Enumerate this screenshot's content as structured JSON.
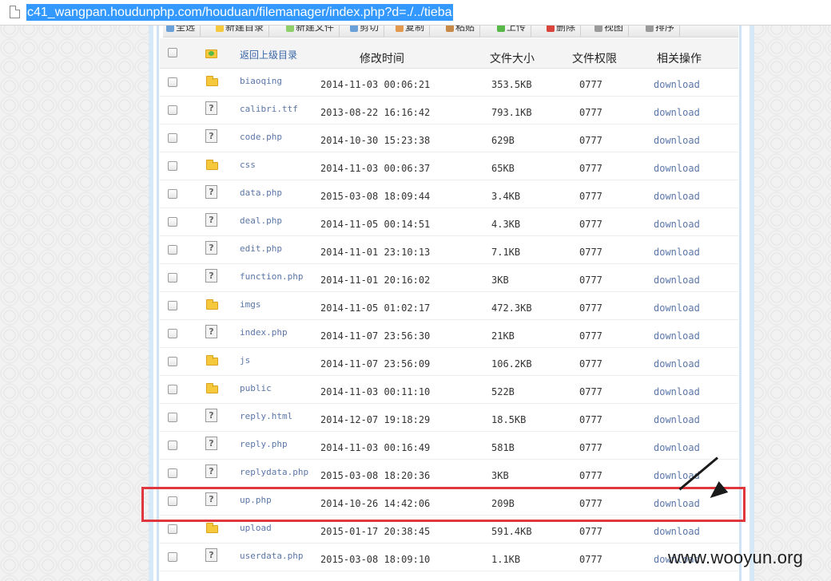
{
  "browser": {
    "url": "c41_wangpan.houdunphp.com/houduan/filemanager/index.php?d=./../tieba"
  },
  "toolbar": {
    "buttons": [
      "全选",
      "新建目录",
      "新建文件",
      "剪切",
      "复制",
      "粘贴",
      "上传",
      "删除",
      "视图",
      "排序"
    ]
  },
  "table": {
    "back_link": "返回上级目录",
    "headers": {
      "time": "修改时间",
      "size": "文件大小",
      "perm": "文件权限",
      "action": "相关操作"
    },
    "rows": [
      {
        "type": "folder",
        "name": "biaoqing",
        "time": "2014-11-03 00:06:21",
        "size": "353.5KB",
        "perm": "0777",
        "action": "download"
      },
      {
        "type": "file",
        "name": "calibri.ttf",
        "time": "2013-08-22 16:16:42",
        "size": "793.1KB",
        "perm": "0777",
        "action": "download"
      },
      {
        "type": "file",
        "name": "code.php",
        "time": "2014-10-30 15:23:38",
        "size": "629B",
        "perm": "0777",
        "action": "download"
      },
      {
        "type": "folder",
        "name": "css",
        "time": "2014-11-03 00:06:37",
        "size": "65KB",
        "perm": "0777",
        "action": "download"
      },
      {
        "type": "file",
        "name": "data.php",
        "time": "2015-03-08 18:09:44",
        "size": "3.4KB",
        "perm": "0777",
        "action": "download"
      },
      {
        "type": "file",
        "name": "deal.php",
        "time": "2014-11-05 00:14:51",
        "size": "4.3KB",
        "perm": "0777",
        "action": "download"
      },
      {
        "type": "file",
        "name": "edit.php",
        "time": "2014-11-01 23:10:13",
        "size": "7.1KB",
        "perm": "0777",
        "action": "download"
      },
      {
        "type": "file",
        "name": "function.php",
        "time": "2014-11-01 20:16:02",
        "size": "3KB",
        "perm": "0777",
        "action": "download"
      },
      {
        "type": "folder",
        "name": "imgs",
        "time": "2014-11-05 01:02:17",
        "size": "472.3KB",
        "perm": "0777",
        "action": "download"
      },
      {
        "type": "file",
        "name": "index.php",
        "time": "2014-11-07 23:56:30",
        "size": "21KB",
        "perm": "0777",
        "action": "download"
      },
      {
        "type": "folder",
        "name": "js",
        "time": "2014-11-07 23:56:09",
        "size": "106.2KB",
        "perm": "0777",
        "action": "download"
      },
      {
        "type": "folder",
        "name": "public",
        "time": "2014-11-03 00:11:10",
        "size": "522B",
        "perm": "0777",
        "action": "download"
      },
      {
        "type": "file",
        "name": "reply.html",
        "time": "2014-12-07 19:18:29",
        "size": "18.5KB",
        "perm": "0777",
        "action": "download"
      },
      {
        "type": "file",
        "name": "reply.php",
        "time": "2014-11-03 00:16:49",
        "size": "581B",
        "perm": "0777",
        "action": "download"
      },
      {
        "type": "file",
        "name": "replydata.php",
        "time": "2015-03-08 18:20:36",
        "size": "3KB",
        "perm": "0777",
        "action": "download"
      },
      {
        "type": "file",
        "name": "up.php",
        "time": "2014-10-26 14:42:06",
        "size": "209B",
        "perm": "0777",
        "action": "download"
      },
      {
        "type": "folder",
        "name": "upload",
        "time": "2015-01-17 20:38:45",
        "size": "591.4KB",
        "perm": "0777",
        "action": "download"
      },
      {
        "type": "file",
        "name": "userdata.php",
        "time": "2015-03-08 18:09:10",
        "size": "1.1KB",
        "perm": "0777",
        "action": "download"
      }
    ]
  },
  "colors": {
    "link": "#5b76a8",
    "highlight": "#e0373f",
    "url_selection": "#3399ff"
  },
  "icons": {
    "folder": "folder-icon",
    "file": "unknown-file-icon",
    "up": "folder-up-icon"
  },
  "watermark": "www.wooyun.org"
}
